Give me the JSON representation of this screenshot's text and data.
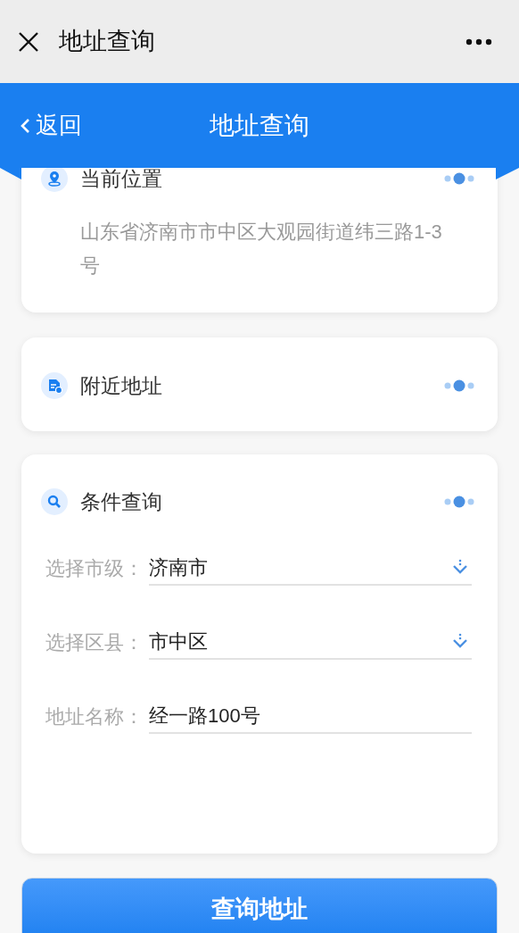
{
  "top_bar": {
    "title": "地址查询"
  },
  "header": {
    "back_label": "返回",
    "title": "地址查询"
  },
  "sections": [
    {
      "kind": "location",
      "title": "当前位置",
      "text": "山东省济南市市中区大观园街道纬三路1-3号"
    },
    {
      "kind": "nearby",
      "title": "附近地址"
    },
    {
      "kind": "search",
      "title": "条件查询",
      "fields": [
        {
          "kind": "select",
          "label": "选择市级：",
          "value": "济南市"
        },
        {
          "kind": "select",
          "label": "选择区县：",
          "value": "市中区"
        },
        {
          "kind": "text",
          "label": "地址名称：",
          "value": "经一路100号"
        }
      ]
    }
  ],
  "submit_button": "查询地址"
}
